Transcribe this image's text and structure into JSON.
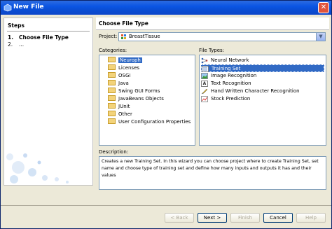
{
  "window": {
    "title": "New File"
  },
  "steps": {
    "title": "Steps",
    "items": [
      {
        "num": "1.",
        "label": "Choose File Type"
      },
      {
        "num": "2.",
        "label": "..."
      }
    ]
  },
  "main": {
    "header": "Choose File Type",
    "project_label": "Project:",
    "project_value": "BreastTissue",
    "categories_label": "Categories:",
    "file_types_label": "File Types:",
    "description_label": "Description:",
    "description": "Creates a new Training Set. In this wizard you can choose project where to create Training Set, set name and choose type of training set and define how many inputs and outputs it has and their values"
  },
  "categories": [
    "Neuroph",
    "Licenses",
    "OSGi",
    "Java",
    "Swing GUI Forms",
    "JavaBeans Objects",
    "JUnit",
    "Other",
    "User Configuration Properties"
  ],
  "selected_category": "Neuroph",
  "file_types": [
    {
      "label": "Neural Network",
      "icon": "neural-network-icon"
    },
    {
      "label": "Training Set",
      "icon": "training-set-icon"
    },
    {
      "label": "Image Recognition",
      "icon": "image-recognition-icon"
    },
    {
      "label": "Text Recognition",
      "icon": "text-recognition-icon"
    },
    {
      "label": "Hand Written Character Recognition",
      "icon": "handwriting-icon"
    },
    {
      "label": "Stock Prediction",
      "icon": "stock-prediction-icon"
    }
  ],
  "selected_file_type": "Training Set",
  "buttons": {
    "back": "< Back",
    "next": "Next >",
    "finish": "Finish",
    "cancel": "Cancel",
    "help": "Help"
  },
  "colors": {
    "titlebar": "#0b55e3",
    "selection": "#316ac5",
    "dialog_bg": "#ece9d8"
  }
}
